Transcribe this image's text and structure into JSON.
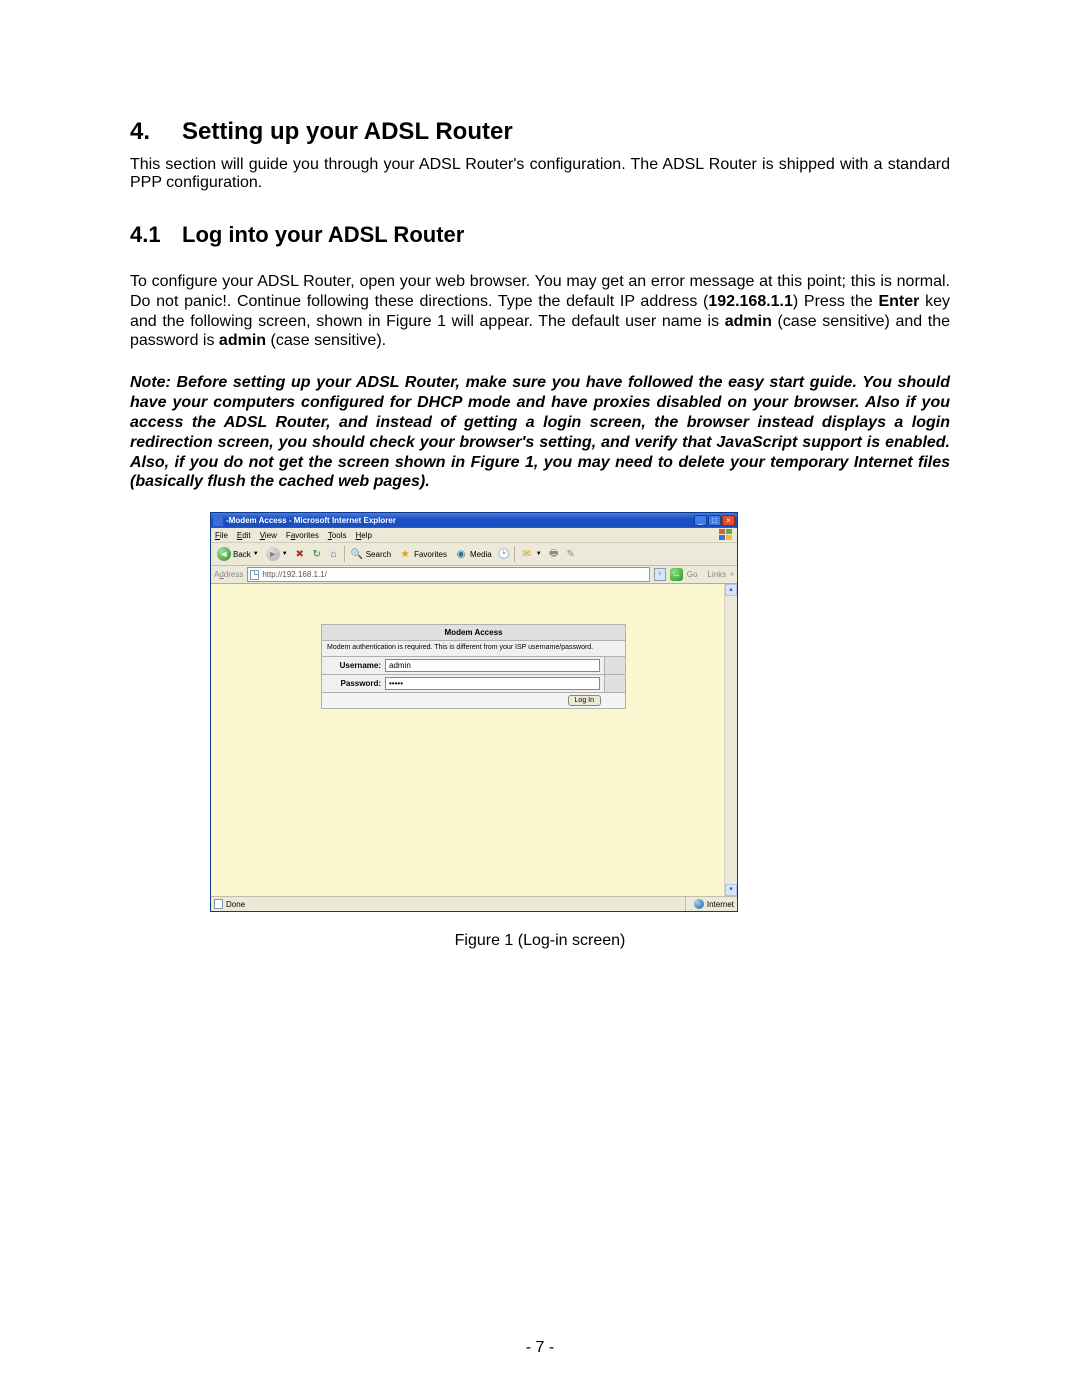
{
  "heading": {
    "num": "4.",
    "title": "Setting up your ADSL Router"
  },
  "intro": "This section will guide you through your ADSL Router's configuration. The ADSL Router is shipped with a standard PPP configuration.",
  "sub": {
    "num": "4.1",
    "title": "Log into your ADSL Router"
  },
  "para1_a": "To configure your ADSL Router, open your web browser.  You may get an error message at this point; this is normal.  Do not panic!. Continue following these directions. Type the default IP address (",
  "para1_ip": "192.168.1.1",
  "para1_b": ") Press the ",
  "para1_enter": "Enter",
  "para1_c": " key and the following screen, shown in Figure 1 will appear. The default user name is ",
  "para1_admin1": "admin",
  "para1_d": " (case sensitive) and the password is ",
  "para1_admin2": "admin",
  "para1_e": "  (case sensitive).",
  "note": "Note: Before setting up your ADSL Router, make sure you have followed the easy start guide.  You should have your computers configured for DHCP mode and have proxies disabled on your browser.  Also if you access the ADSL Router, and instead of getting a login screen, the browser instead displays a login redirection screen, you should check your browser's setting, and verify that JavaScript support is enabled.  Also, if you do not get the screen shown in Figure 1, you may need to delete your temporary Internet files (basically flush the cached web pages).",
  "browser": {
    "title": "-Modem Access - Microsoft Internet Explorer",
    "menu": [
      "File",
      "Edit",
      "View",
      "Favorites",
      "Tools",
      "Help"
    ],
    "back": "Back",
    "search": "Search",
    "favorites": "Favorites",
    "media": "Media",
    "addr_label": "Address",
    "url": "http://192.168.1.1/",
    "go": "Go",
    "links": "Links",
    "status_done": "Done",
    "status_zone": "Internet"
  },
  "login": {
    "header": "Modem Access",
    "msg": "Modem authentication is required. This is different from your ISP username/password.",
    "username_label": "Username:",
    "username_value": "admin",
    "password_label": "Password:",
    "password_value": "•••••",
    "submit": "Log In"
  },
  "figcap": "Figure 1 (Log-in screen)",
  "page_num": "- 7 -"
}
